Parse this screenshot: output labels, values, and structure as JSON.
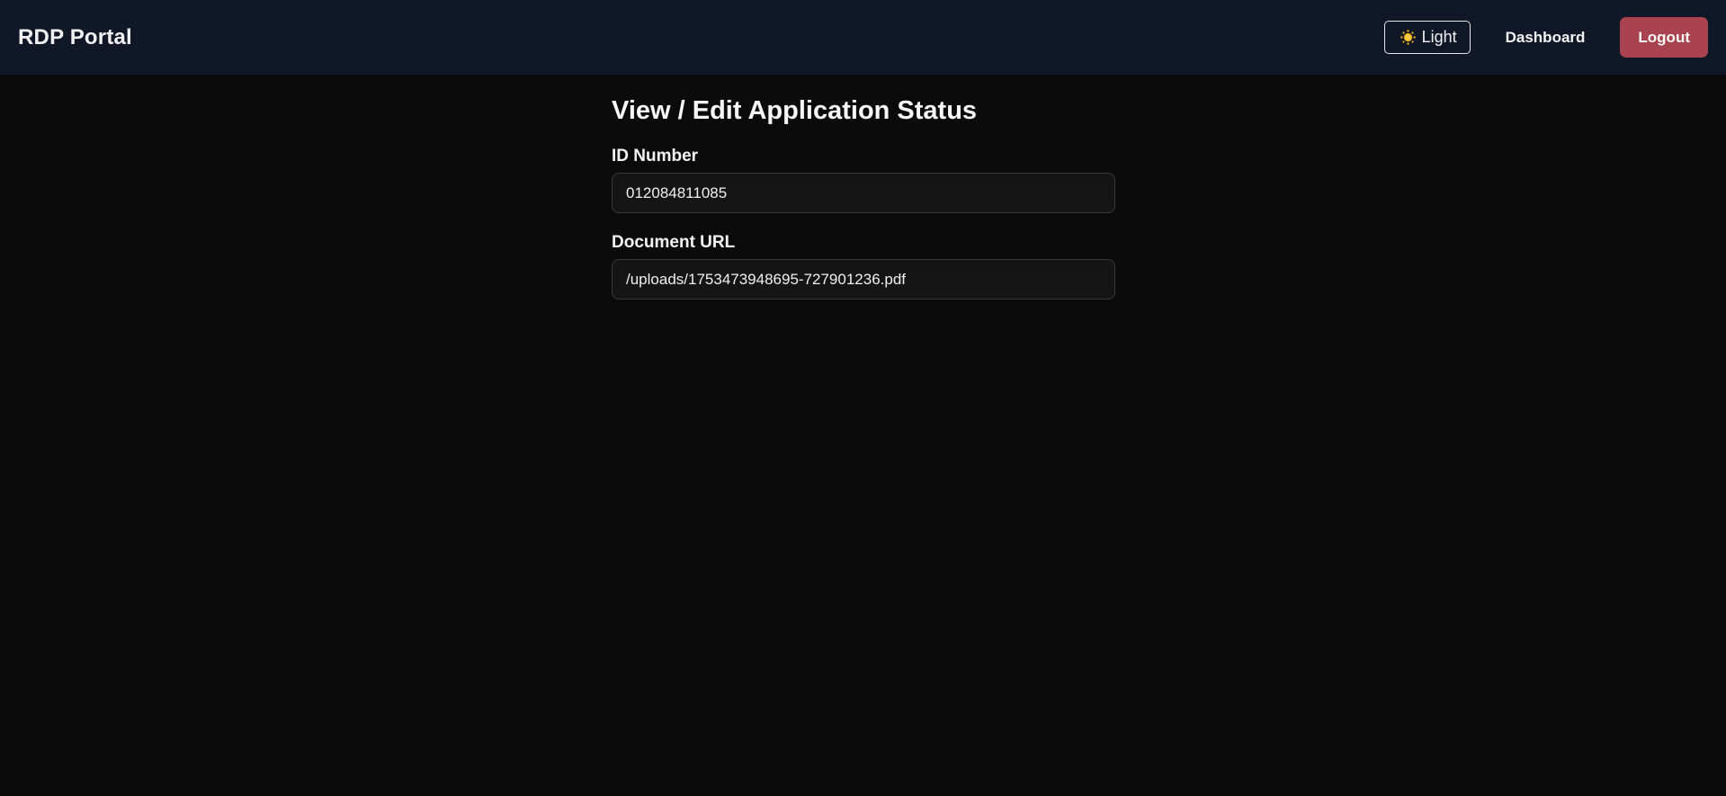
{
  "header": {
    "brand": "RDP Portal",
    "theme_toggle": {
      "icon": "sun-icon",
      "label": "Light"
    },
    "dashboard_label": "Dashboard",
    "logout_label": "Logout"
  },
  "main": {
    "title": "View / Edit Application Status",
    "fields": [
      {
        "label": "ID Number",
        "value": "012084811085"
      },
      {
        "label": "Document URL",
        "value": "/uploads/1753473948695-727901236.pdf"
      }
    ]
  },
  "colors": {
    "navbar_bg": "#101727",
    "page_bg": "#0b0b0b",
    "logout_bg": "#a8434f",
    "input_bg": "#151515",
    "sun_icon": "#f4b41a"
  }
}
